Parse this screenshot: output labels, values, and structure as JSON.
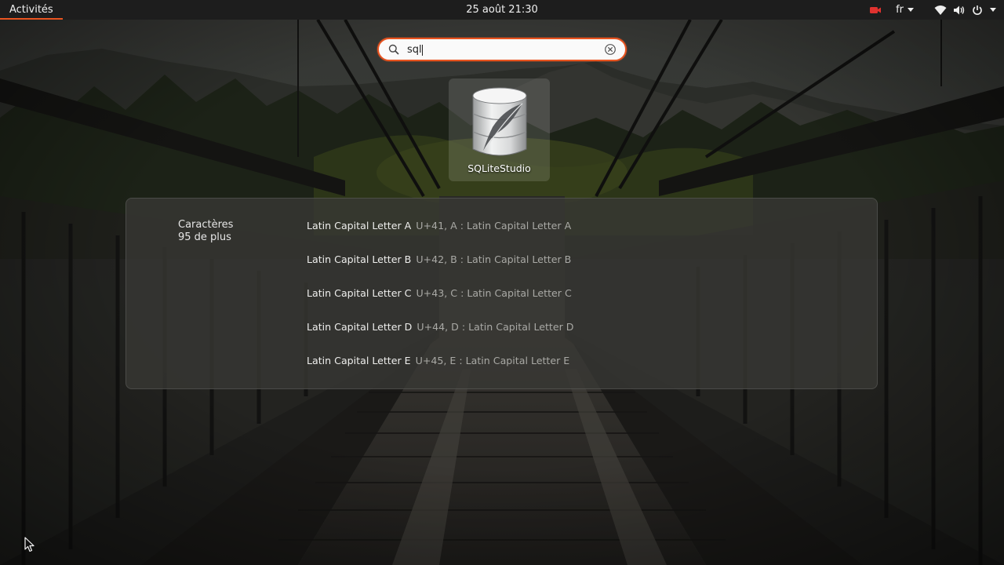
{
  "topbar": {
    "activities_label": "Activités",
    "clock": "25 août  21:30",
    "keyboard_layout": "fr"
  },
  "search": {
    "value": "sql",
    "placeholder": ""
  },
  "app_result": {
    "name": "SQLiteStudio",
    "icon": "sqlitestudio-icon"
  },
  "characters": {
    "provider_name": "Caractères",
    "more_count": "95 de plus",
    "results": [
      {
        "name": "Latin Capital Letter A",
        "desc": "U+41, A : Latin Capital Letter A"
      },
      {
        "name": "Latin Capital Letter B",
        "desc": "U+42, B : Latin Capital Letter B"
      },
      {
        "name": "Latin Capital Letter C",
        "desc": "U+43, C : Latin Capital Letter C"
      },
      {
        "name": "Latin Capital Letter D",
        "desc": "U+44, D : Latin Capital Letter D"
      },
      {
        "name": "Latin Capital Letter E",
        "desc": "U+45, E : Latin Capital Letter E"
      }
    ]
  },
  "colors": {
    "accent": "#e95420",
    "topbar_bg": "#1d1d1d",
    "recording_red": "#e0322f"
  }
}
